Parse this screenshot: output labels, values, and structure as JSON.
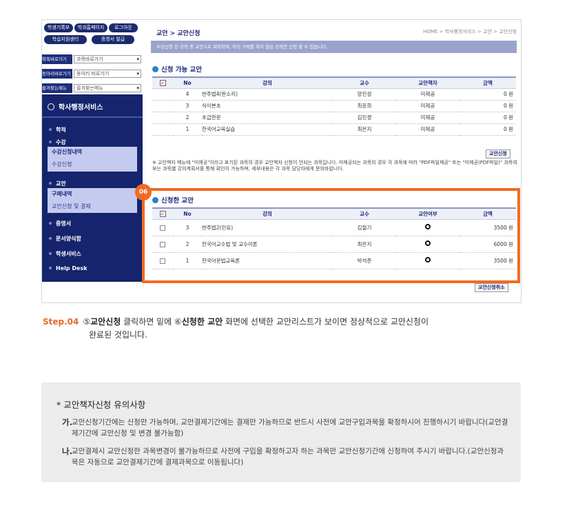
{
  "sidebar": {
    "top_buttons": [
      "학생기록부",
      "학과홈페이지",
      "로그아웃",
      "학습지원센터",
      "증명서 발급"
    ],
    "selects": [
      {
        "label": "학목바로가기",
        "value": "과목바로가기"
      },
      {
        "label": "동아리바로가기",
        "value": "동아리 바로가기"
      },
      {
        "label": "즐겨찾는메뉴",
        "value": "즐겨찾는메뉴"
      }
    ],
    "nav_title": "학사행정서비스",
    "nav": {
      "hakjeok": "학적",
      "sugang": "수강",
      "sugang_sub1": "수강신청내역",
      "sugang_sub2": "수강신청",
      "gyoan": "교안",
      "gyoan_sub1": "구매내역",
      "gyoan_sub2": "교안신청 및 결제",
      "cert": "증명서",
      "doc": "문서양식함",
      "student": "학생서비스",
      "help": "Help Desk"
    }
  },
  "main": {
    "title": "교안 > 교안신청",
    "home_crumb": "HOME > 학사행정서비스 > 교안 > 교안신청",
    "info": "수강신청 된 강의 중 교안으로 제작되며, 아직 구매를 하지 않은 강의만 신청 할 수 있습니다.",
    "available": {
      "heading": "신청 가능 교안",
      "headers": [
        "No",
        "강의",
        "교수",
        "교안책자",
        "금액"
      ],
      "rows": [
        {
          "no": "4",
          "course": "반주법4(판소리)",
          "prof": "양진성",
          "book": "미제공",
          "price": "0 원"
        },
        {
          "no": "3",
          "course": "식이본초",
          "prof": "최윤희",
          "book": "미제공",
          "price": "0 원"
        },
        {
          "no": "2",
          "course": "초급한문",
          "prof": "김진경",
          "book": "미제공",
          "price": "0 원"
        },
        {
          "no": "1",
          "course": "한국어교육실습",
          "prof": "최은지",
          "book": "미제공",
          "price": "0 원"
        }
      ],
      "apply_button": "교안신청"
    },
    "note": "※ 교안책자 메뉴에 \"미제공\"이라고 표기된 과목의 경우 교안책자 신청이 안되는 과목입니다. 미제공되는 과목의 경우 각 과목에 따라 \"PDF파일제공\" 또는 \"미제공(PDF파일)\" 과목여부는 과목별 강의계획서를 통해 확인이 가능하며, 세부내용은 각 과목 담당자에게 문의바랍니다.",
    "applied": {
      "badge": "06",
      "heading": "신청한 교안",
      "headers": [
        "No",
        "강의",
        "교수",
        "교안여부",
        "금액"
      ],
      "rows": [
        {
          "no": "3",
          "course": "반주법2(민요)",
          "prof": "김철기",
          "price": "3500 원"
        },
        {
          "no": "2",
          "course": "한국어교수법 및 교수이론",
          "prof": "최은지",
          "price": "6000 원"
        },
        {
          "no": "1",
          "course": "한국어문법교육론",
          "prof": "박석준",
          "price": "3500 원"
        }
      ],
      "cancel_button": "교안신청취소"
    }
  },
  "step": {
    "num": "Step.04",
    "marker1": "⑤",
    "bold1": "교안신청",
    "text1": " 클릭하면 밑에 ",
    "marker2": "⑥",
    "bold2": "신청한 교안",
    "text2": " 화면에 선택한 교안리스트가 보이면 정상적으로 교안신청이",
    "line2": "완료된 것입니다."
  },
  "notice": {
    "title": "* 교안책자신청 유의사항",
    "items": [
      {
        "key": "가.",
        "text": "교안신청기간에는 신청만 가능하며, 교안결제기간에는 결제만 가능하므로 반드시 사전에 교안구입과목을 확정하시어 진행하시기 바랍니다(교안결제기간에 교안신청 및 변경 불가능함)"
      },
      {
        "key": "나.",
        "text": "교안결제시 교안신청한 과목변경이 불가능하므로 사전에 구입을 확정하고자 하는 과목만 교안신청기간에 신청하여 주시기 바랍니다.(교안신청과목은 자동으로 교안결제기간에 결제과목으로 이동됩니다)"
      }
    ]
  },
  "colors": {
    "accent": "#f26a21",
    "navy": "#15246c",
    "highlight_sub": "#c5cbef"
  }
}
